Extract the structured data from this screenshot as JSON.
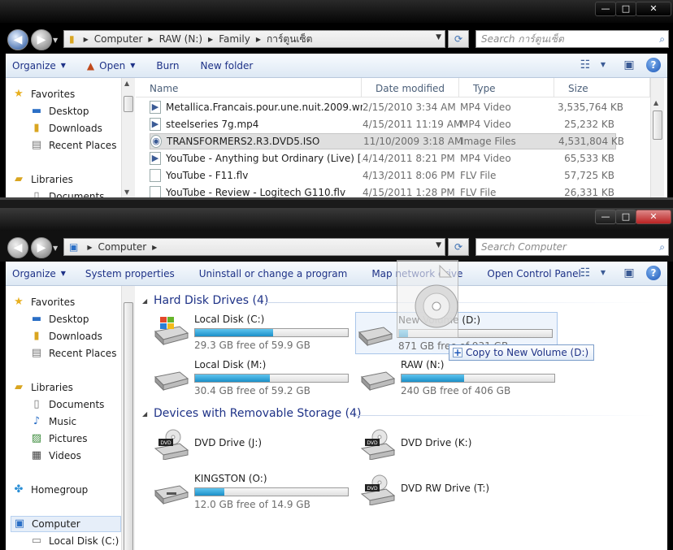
{
  "win1": {
    "caption": {
      "min": "—",
      "max": "□",
      "close": "✕"
    },
    "address": [
      "Computer",
      "RAW (N:)",
      "Family",
      "การ์ตูนเซ็ต"
    ],
    "search_placeholder": "Search การ์ตูนเซ็ต",
    "toolbar": {
      "organize": "Organize",
      "open": "Open",
      "burn": "Burn",
      "new_folder": "New folder"
    },
    "nav": {
      "favorites": "Favorites",
      "desktop": "Desktop",
      "downloads": "Downloads",
      "recent": "Recent Places",
      "libraries": "Libraries",
      "documents": "Documents"
    },
    "columns": {
      "name": "Name",
      "date": "Date modified",
      "type": "Type",
      "size": "Size"
    },
    "files": [
      {
        "name": "Metallica.Francais.pour.une.nuit.2009.wr...",
        "date": "2/15/2010 3:34 AM",
        "type": "MP4 Video",
        "size": "3,535,764 KB"
      },
      {
        "name": "steelseries 7g.mp4",
        "date": "4/15/2011 11:19 AM",
        "type": "MP4 Video",
        "size": "25,232 KB"
      },
      {
        "name": "TRANSFORMERS2.R3.DVD5.ISO",
        "date": "11/10/2009 3:18 AM",
        "type": "Image Files",
        "size": "4,531,804 KB"
      },
      {
        "name": "YouTube - Anything but Ordinary (Live) [...",
        "date": "4/14/2011 8:21 PM",
        "type": "MP4 Video",
        "size": "65,533 KB"
      },
      {
        "name": "YouTube - F11.flv",
        "date": "4/13/2011 8:06 PM",
        "type": "FLV File",
        "size": "57,725 KB"
      },
      {
        "name": "YouTube - Review - Logitech G110.flv",
        "date": "4/15/2011 1:28 PM",
        "type": "FLV File",
        "size": "26,331 KB"
      }
    ]
  },
  "win2": {
    "caption": {
      "min": "—",
      "max": "□",
      "close": "✕"
    },
    "address": [
      "Computer"
    ],
    "search_placeholder": "Search Computer",
    "toolbar": {
      "organize": "Organize",
      "system_properties": "System properties",
      "uninstall": "Uninstall or change a program",
      "map_network": "Map network drive",
      "control_panel": "Open Control Panel"
    },
    "nav": {
      "favorites": "Favorites",
      "desktop": "Desktop",
      "downloads": "Downloads",
      "recent": "Recent Places",
      "libraries": "Libraries",
      "documents": "Documents",
      "music": "Music",
      "pictures": "Pictures",
      "videos": "Videos",
      "homegroup": "Homegroup",
      "computer": "Computer",
      "local_c": "Local Disk (C:)"
    },
    "groups": {
      "hdd": "Hard Disk Drives (4)",
      "removable": "Devices with Removable Storage (4)"
    },
    "drives": [
      {
        "name": "Local Disk (C:)",
        "free": "29.3 GB free of 59.9 GB",
        "used_fraction": 0.51
      },
      {
        "name": "New Volume (D:)",
        "free": "871 GB free of 931 GB",
        "used_fraction": 0.06
      },
      {
        "name": "Local Disk (M:)",
        "free": "30.4 GB free of 59.2 GB",
        "used_fraction": 0.49
      },
      {
        "name": "RAW (N:)",
        "free": "240 GB free of 406 GB",
        "used_fraction": 0.41
      }
    ],
    "removable": [
      {
        "name": "DVD Drive (J:)",
        "label": "DVD"
      },
      {
        "name": "DVD Drive (K:)",
        "label": "DVD"
      },
      {
        "name": "KINGSTON (O:)",
        "free": "12.0 GB free of 14.9 GB",
        "used_fraction": 0.19
      },
      {
        "name": "DVD RW Drive (T:)",
        "label": "DVD"
      }
    ],
    "drag_tooltip": "Copy to New Volume (D:)"
  },
  "colors": {
    "accent": "#1e3287",
    "bar": "#26a0da",
    "selection": "#dfdfdf"
  }
}
